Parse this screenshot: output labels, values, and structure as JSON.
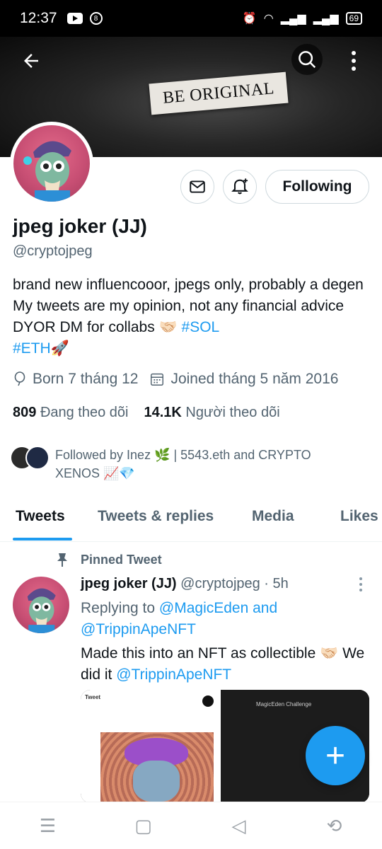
{
  "status_bar": {
    "time": "12:37",
    "battery": "69"
  },
  "banner": {
    "text": "BE ORIGINAL"
  },
  "profile": {
    "name": "jpeg joker (JJ)",
    "handle": "@cryptojpeg",
    "bio_main": "brand new influencooor, jpegs only, probably a degen My tweets are my opinion, not any financial advice DYOR DM for collabs 🤝🏻 ",
    "bio_tag1": "#SOL",
    "bio_tag2": "#ETH",
    "bio_end": "🚀",
    "birthday": "Born 7 tháng 12",
    "joined": "Joined tháng 5 năm 2016",
    "following_count": "809",
    "following_label": "Đang theo dõi",
    "followers_count": "14.1K",
    "followers_label": "Người theo dõi",
    "followed_by": "Followed by Inez 🌿 | 5543.eth and CRYPTO XENOS 📈💎"
  },
  "actions": {
    "following_label": "Following"
  },
  "tabs": [
    "Tweets",
    "Tweets & replies",
    "Media",
    "Likes"
  ],
  "tweet": {
    "pinned_label": "Pinned Tweet",
    "name": "jpeg joker (JJ)",
    "handle_time": "@cryptojpeg · 5h",
    "replying_prefix": "Replying to ",
    "replying_users": "@MagicEden and @TrippinApeNFT",
    "text_main": "Made this into an NFT as collectible 🤝🏻 We did it ",
    "text_mention": "@TrippinApeNFT",
    "media_left_title": "Tweet",
    "media_right_title": "MagicEden Challenge"
  },
  "colors": {
    "accent": "#1d9bf0",
    "muted": "#536471"
  }
}
